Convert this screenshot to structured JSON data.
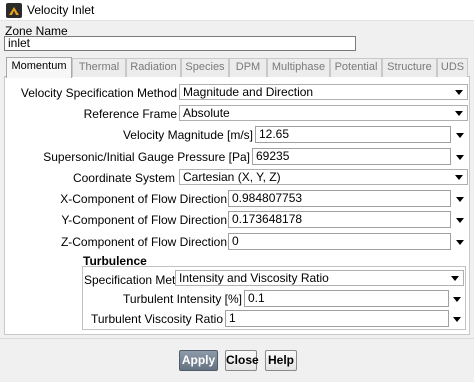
{
  "window": {
    "title": "Velocity Inlet"
  },
  "zone": {
    "label": "Zone Name",
    "value": "inlet"
  },
  "tabs": [
    {
      "label": "Momentum",
      "active": true
    },
    {
      "label": "Thermal",
      "active": false
    },
    {
      "label": "Radiation",
      "active": false
    },
    {
      "label": "Species",
      "active": false
    },
    {
      "label": "DPM",
      "active": false
    },
    {
      "label": "Multiphase",
      "active": false
    },
    {
      "label": "Potential",
      "active": false
    },
    {
      "label": "Structure",
      "active": false
    },
    {
      "label": "UDS",
      "active": false
    }
  ],
  "momentum": {
    "spec_method": {
      "label": "Velocity Specification Method",
      "value": "Magnitude and Direction"
    },
    "reference_frame": {
      "label": "Reference Frame",
      "value": "Absolute"
    },
    "velocity_magnitude": {
      "label": "Velocity Magnitude [m/s]",
      "value": "12.65"
    },
    "gauge_pressure": {
      "label": "Supersonic/Initial Gauge Pressure [Pa]",
      "value": "69235"
    },
    "coordinate_system": {
      "label": "Coordinate System",
      "value": "Cartesian (X, Y, Z)"
    },
    "x_component": {
      "label": "X-Component of Flow Direction",
      "value": "0.984807753"
    },
    "y_component": {
      "label": "Y-Component of Flow Direction",
      "value": "0.173648178"
    },
    "z_component": {
      "label": "Z-Component of Flow Direction",
      "value": "0"
    }
  },
  "turbulence": {
    "title": "Turbulence",
    "spec_method": {
      "label": "Specification Method",
      "value": "Intensity and Viscosity Ratio"
    },
    "intensity": {
      "label": "Turbulent Intensity [%]",
      "value": "0.1"
    },
    "viscosity_ratio": {
      "label": "Turbulent Viscosity Ratio",
      "value": "1"
    }
  },
  "buttons": {
    "apply": "Apply",
    "close": "Close",
    "help": "Help"
  }
}
